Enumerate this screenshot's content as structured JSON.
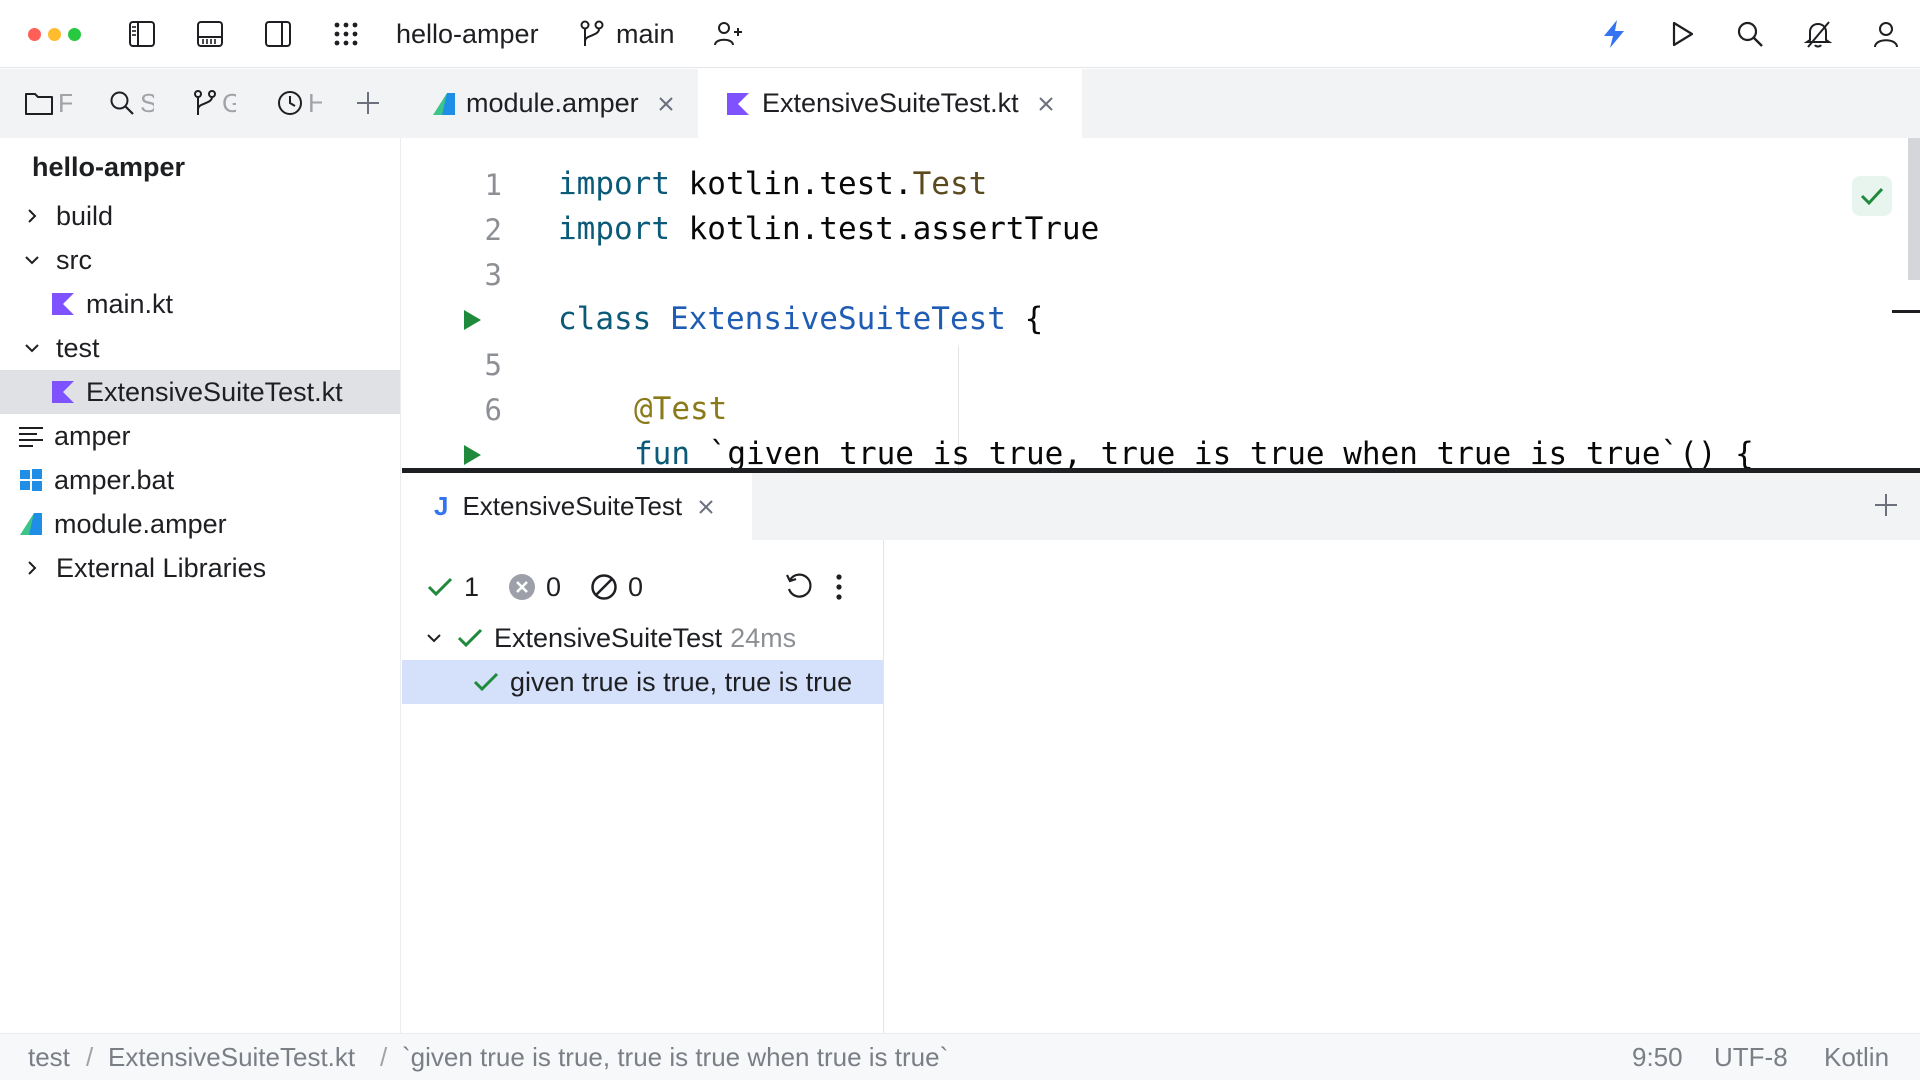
{
  "colors": {
    "traffic_red": "#ff5f57",
    "traffic_yellow": "#febc2e",
    "traffic_green": "#28c840",
    "accent_blue": "#3574f0",
    "success_green": "#208a3c",
    "kotlin_purple": "#7f52ff",
    "amper_green": "#3dc489",
    "selection_blue": "#d5e1fa"
  },
  "titlebar": {
    "project_name": "hello-amper",
    "branch": "main",
    "icons": [
      "sidebar-left-icon",
      "panel-bottom-icon",
      "sidebar-right-icon",
      "apps-grid-icon",
      "git-branch-icon",
      "add-user-icon",
      "lightning-icon",
      "run-icon",
      "search-icon",
      "notifications-off-icon",
      "profile-icon"
    ]
  },
  "tool_tabs": [
    {
      "icon": "folder-icon",
      "label": "F"
    },
    {
      "icon": "search-icon",
      "label": "S"
    },
    {
      "icon": "git-icon",
      "label": "G"
    },
    {
      "icon": "history-icon",
      "label": "H"
    }
  ],
  "project": {
    "root": "hello-amper",
    "items": [
      {
        "label": "build",
        "icon": "chevron-right-icon"
      },
      {
        "label": "src",
        "icon": "chevron-down-icon"
      },
      {
        "label": "main.kt",
        "icon": "kotlin-file-icon"
      },
      {
        "label": "test",
        "icon": "chevron-down-icon"
      },
      {
        "label": "ExtensiveSuiteTest.kt",
        "icon": "kotlin-file-icon"
      },
      {
        "label": "amper",
        "icon": "text-file-icon"
      },
      {
        "label": "amper.bat",
        "icon": "windows-icon"
      },
      {
        "label": "module.amper",
        "icon": "amper-icon"
      },
      {
        "label": "External Libraries",
        "icon": "chevron-right-icon"
      }
    ]
  },
  "editor_tabs": [
    {
      "label": "module.amper",
      "icon": "amper-icon"
    },
    {
      "label": "ExtensiveSuiteTest.kt",
      "icon": "kotlin-file-icon"
    }
  ],
  "code": {
    "line_numbers": [
      "1",
      "2",
      "3",
      "5",
      "6"
    ],
    "lines": [
      {
        "kw": "import",
        "rest": " kotlin.test.",
        "cls": "Test"
      },
      {
        "kw": "import",
        "rest": " kotlin.test.assertTrue"
      },
      {
        "kw": "class",
        "decl": "ExtensiveSuiteTest",
        "rest": " {"
      },
      {
        "ann": "@Test"
      },
      {
        "kw": "fun",
        "rest": " `given true is true, true is true when true is true`() {"
      }
    ]
  },
  "run": {
    "tab_label": "ExtensiveSuiteTest",
    "tab_prefix": "J",
    "passed": "1",
    "failed": "0",
    "ignored": "0",
    "suite": {
      "name": "ExtensiveSuiteTest",
      "duration": "24ms"
    },
    "test": {
      "name": "given true is true, true is true"
    }
  },
  "statusbar": {
    "breadcrumbs": [
      "test",
      "ExtensiveSuiteTest.kt",
      "`given true is true, true is true when true is true`"
    ],
    "separator": "/",
    "position": "9:50",
    "encoding": "UTF-8",
    "language": "Kotlin"
  }
}
